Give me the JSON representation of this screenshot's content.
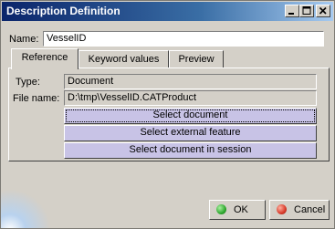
{
  "window": {
    "title": "Description Definition"
  },
  "name_field": {
    "label": "Name:",
    "value": "VesselID"
  },
  "tabs": [
    {
      "label": "Reference",
      "active": true
    },
    {
      "label": "Keyword values",
      "active": false
    },
    {
      "label": "Preview",
      "active": false
    }
  ],
  "reference": {
    "type_label": "Type:",
    "type_value": "Document",
    "file_label": "File name:",
    "file_value": "D:\\tmp\\VesselID.CATProduct",
    "buttons": [
      "Select document",
      "Select external feature",
      "Select document in session"
    ]
  },
  "footer": {
    "ok_label": "OK",
    "cancel_label": "Cancel"
  },
  "colors": {
    "title_bar": "#0a246a",
    "action_button": "#c8c3e6",
    "ok_icon": "#2fa82f",
    "cancel_icon": "#d83a2a"
  },
  "icons": [
    "minimize-icon",
    "maximize-icon",
    "close-icon",
    "ok-icon",
    "cancel-icon"
  ]
}
